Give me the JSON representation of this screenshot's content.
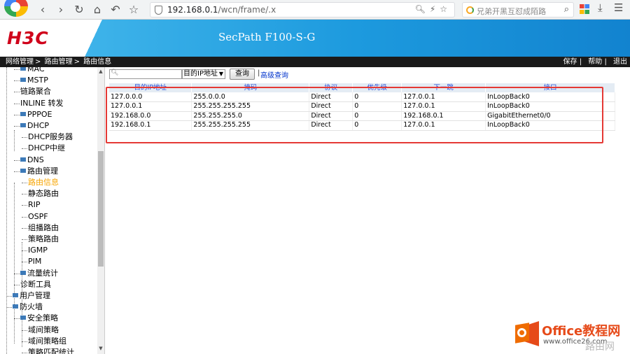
{
  "browser": {
    "url_host": "192.168.0.1",
    "url_path": "/wcn/frame/.x",
    "search_placeholder": "兄弟开黑互怼成陌路",
    "icons": [
      "back-icon",
      "forward-icon",
      "refresh-icon",
      "home-icon",
      "undo-icon",
      "star-icon",
      "shield-icon",
      "zoom-icon",
      "lightning-icon",
      "search-icon",
      "apps-icon",
      "download-icon",
      "menu-icon"
    ]
  },
  "header": {
    "logo": "H3C",
    "product": "SecPath F100-S-G",
    "accent_color": "#1d9ade",
    "logo_color": "#d0021b"
  },
  "breadcrumb": {
    "items": [
      "网络管理",
      "路由管理",
      "路由信息"
    ],
    "separator": " > "
  },
  "top_links": [
    "保存",
    "帮助",
    "退出"
  ],
  "sidebar": {
    "items": [
      {
        "label": "MAC",
        "icon": true
      },
      {
        "label": "MSTP",
        "icon": true
      },
      {
        "label": "链路聚合",
        "icon": false
      },
      {
        "label": "INLINE 转发",
        "icon": false
      },
      {
        "label": "PPPOE",
        "icon": true
      },
      {
        "label": "DHCP",
        "icon": true
      },
      {
        "label": "DHCP服务器",
        "icon": false
      },
      {
        "label": "DHCP中继",
        "icon": false
      },
      {
        "label": "DNS",
        "icon": true
      },
      {
        "label": "路由管理",
        "icon": true
      },
      {
        "label": "路由信息",
        "icon": false
      },
      {
        "label": "静态路由",
        "icon": false
      },
      {
        "label": "RIP",
        "icon": false
      },
      {
        "label": "OSPF",
        "icon": false
      },
      {
        "label": "组播路由",
        "icon": false
      },
      {
        "label": "策略路由",
        "icon": false
      },
      {
        "label": "IGMP",
        "icon": false
      },
      {
        "label": "PIM",
        "icon": false
      },
      {
        "label": "流量统计",
        "icon": true
      },
      {
        "label": "诊断工具",
        "icon": false
      },
      {
        "label": "用户管理",
        "icon": true
      },
      {
        "label": "防火墙",
        "icon": true
      },
      {
        "label": "安全策略",
        "icon": true
      },
      {
        "label": "域间策略",
        "icon": false
      },
      {
        "label": "域间策略组",
        "icon": false
      },
      {
        "label": "策略匹配统计",
        "icon": false
      }
    ],
    "active": "路由信息"
  },
  "query": {
    "input_value": "",
    "select_value": "目的IP地址",
    "button_label": "查询",
    "separator": "|",
    "advanced_link": "高级查询"
  },
  "table": {
    "columns": [
      "目的IP地址",
      "掩码",
      "协议",
      "优先级",
      "下一跳",
      "接口"
    ],
    "rows": [
      [
        "127.0.0.0",
        "255.0.0.0",
        "Direct",
        "0",
        "127.0.0.1",
        "InLoopBack0"
      ],
      [
        "127.0.0.1",
        "255.255.255.255",
        "Direct",
        "0",
        "127.0.0.1",
        "InLoopBack0"
      ],
      [
        "192.168.0.0",
        "255.255.255.0",
        "Direct",
        "0",
        "192.168.0.1",
        "GigabitEthernet0/0"
      ],
      [
        "192.168.0.1",
        "255.255.255.255",
        "Direct",
        "0",
        "127.0.0.1",
        "InLoopBack0"
      ]
    ],
    "highlight_color": "#e53935"
  },
  "watermark": {
    "title": "Office教程网",
    "url": "www.office26.com",
    "secondary": "路由网"
  }
}
